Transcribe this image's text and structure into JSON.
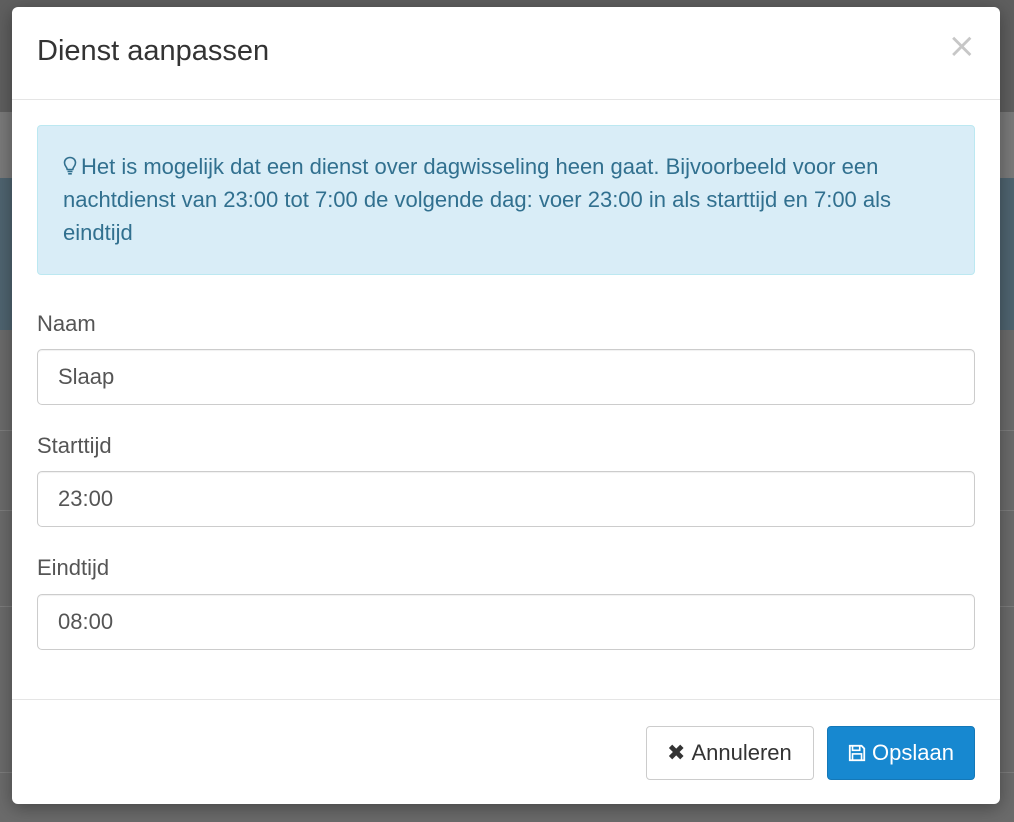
{
  "modal": {
    "title": "Dienst aanpassen",
    "close_symbol": "×",
    "info_icon": "lightbulb-icon",
    "info_text": "Het is mogelijk dat een dienst over dagwisseling heen gaat. Bijvoorbeeld voor een nachtdienst van 23:00 tot 7:00 de volgende dag: voer 23:00 in als starttijd en 7:00 als eindtijd",
    "fields": {
      "name": {
        "label": "Naam",
        "value": "Slaap"
      },
      "start": {
        "label": "Starttijd",
        "value": "23:00"
      },
      "end": {
        "label": "Eindtijd",
        "value": "08:00"
      }
    },
    "buttons": {
      "cancel": {
        "label": "Annuleren",
        "icon": "x-icon",
        "symbol": "✖"
      },
      "save": {
        "label": "Opslaan",
        "icon": "floppy-disk-icon"
      }
    }
  },
  "colors": {
    "alert_bg": "#d9edf7",
    "alert_text": "#31708f",
    "primary": "#1788d0"
  }
}
